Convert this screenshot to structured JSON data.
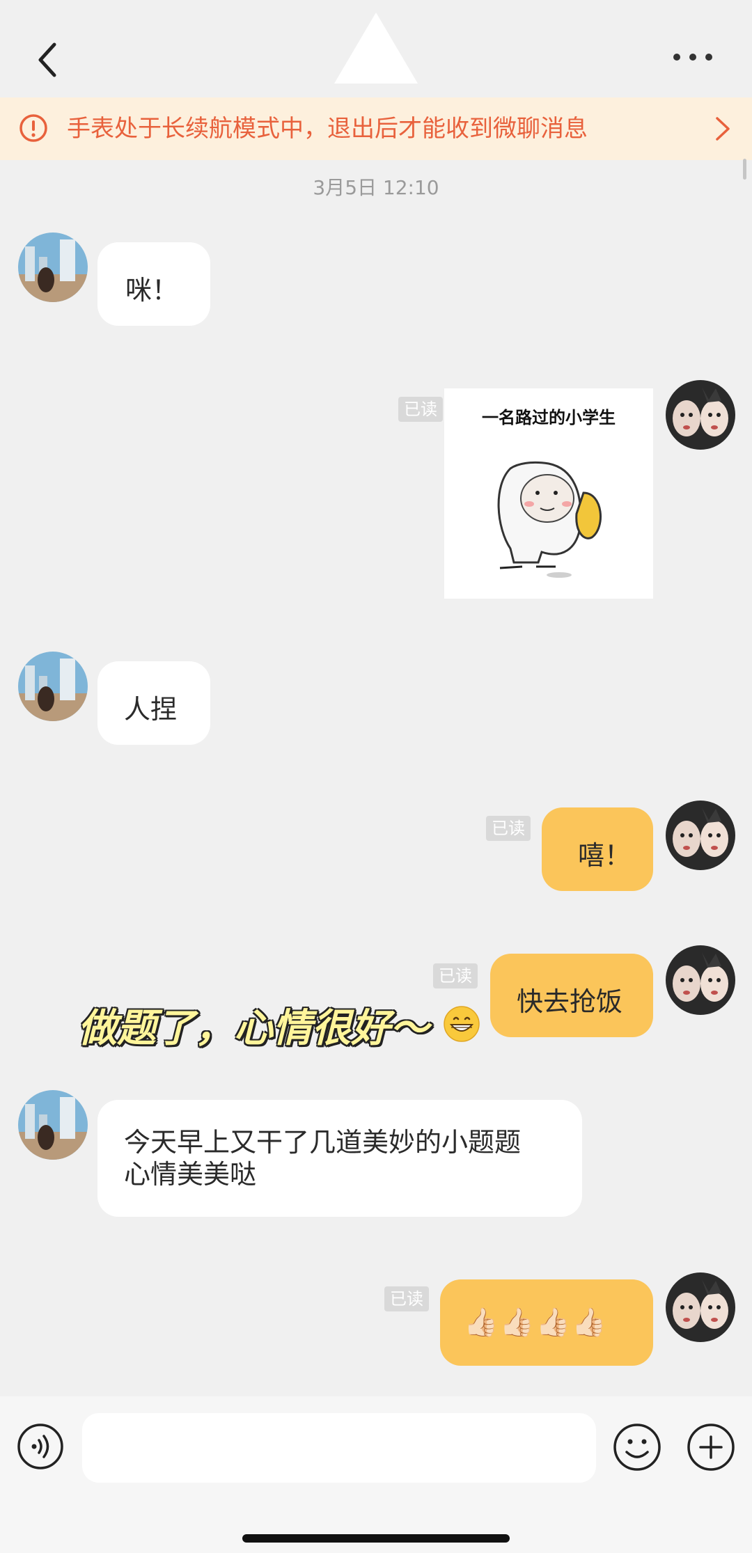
{
  "header": {
    "back_icon": "chevron-left-icon",
    "title_placeholder": "triangle-shape",
    "more_icon": "more-dots-icon"
  },
  "banner": {
    "icon": "exclamation-circle-icon",
    "text": "手表处于长续航模式中，退出后才能收到微聊消息",
    "chevron_icon": "chevron-right-icon",
    "color": "#e8613c",
    "background": "#fdf0dd"
  },
  "timestamp": "3月5日 12:10",
  "messages": [
    {
      "side": "left",
      "text": "咪！"
    },
    {
      "side": "right",
      "read_label": "已读",
      "sticker_caption": "一名路过的小学生"
    },
    {
      "side": "left",
      "text": "人捏"
    },
    {
      "side": "right",
      "read_label": "已读",
      "text": "嘻！"
    },
    {
      "side": "right",
      "read_label": "已读",
      "text": "快去抢饭"
    },
    {
      "side": "left",
      "text_line1": "今天早上又干了几道美妙的小题题",
      "text_line2": "心情美美哒"
    },
    {
      "side": "right",
      "read_label": "已读",
      "text": "👍🏻👍🏻👍🏻👍🏻"
    }
  ],
  "overlay_caption": "做题了，心情很好～",
  "overlay_emoji_icon": "grinning-face-icon",
  "input_bar": {
    "voice_icon": "voice-icon",
    "input_value": "",
    "emoji_icon": "smiley-icon",
    "plus_icon": "plus-circle-icon"
  },
  "colors": {
    "accent_yellow": "#fbc55a",
    "background": "#f0f0f0",
    "bubble_white": "#ffffff"
  }
}
